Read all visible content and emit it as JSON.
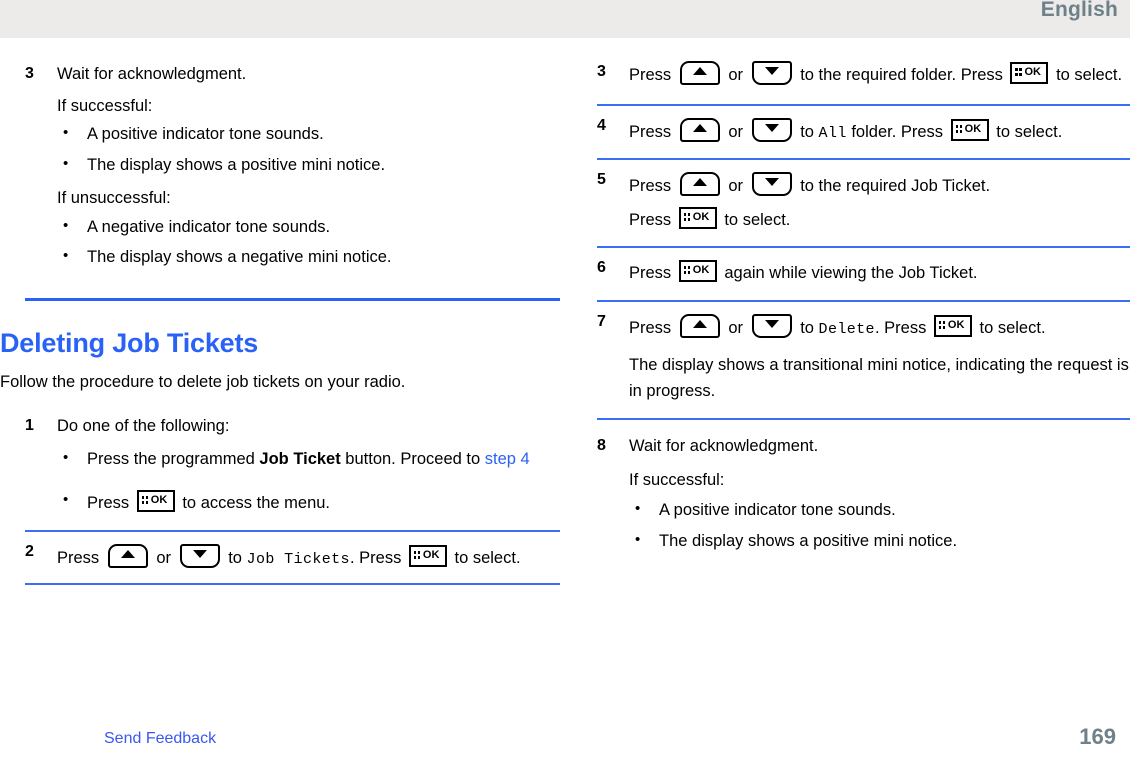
{
  "header": {
    "language": "English"
  },
  "colors": {
    "accent": "#2a62f5",
    "link": "#3a57f0",
    "header_text": "#6e8189",
    "header_band": "#ecebe9"
  },
  "icons": {
    "ok_label": "OK",
    "ok_name": "ok-menu-key-icon",
    "up_name": "up-arrow-key-icon",
    "down_name": "down-arrow-key-icon"
  },
  "left_column": {
    "step3": {
      "number": "3",
      "lead": "Wait for acknowledgment.",
      "success_label": "If successful:",
      "success_bullets": [
        "A positive indicator tone sounds.",
        "The display shows a positive mini notice."
      ],
      "failure_label": "If unsuccessful:",
      "failure_bullets": [
        "A negative indicator tone sounds.",
        "The display shows a negative mini notice."
      ]
    },
    "section": {
      "title": "Deleting Job Tickets",
      "intro": "Follow the procedure to delete job tickets on your radio."
    },
    "step1": {
      "number": "1",
      "lead": "Do one of the following:",
      "bullet1_pre": "Press the programmed ",
      "bullet1_bold": "Job Ticket",
      "bullet1_post": " button. Proceed to ",
      "bullet1_link": "step 4",
      "bullet2_pre": "Press ",
      "bullet2_post": " to access the menu."
    },
    "step2": {
      "number": "2",
      "t1": "Press ",
      "t2": " or ",
      "t3": " to ",
      "mono": "Job Tickets",
      "t4": ". Press ",
      "t5": " to select."
    }
  },
  "right_column": {
    "step3": {
      "number": "3",
      "t1": "Press ",
      "t2": " or ",
      "t3": " to the required folder. Press ",
      "t4": " to select."
    },
    "step4": {
      "number": "4",
      "t1": "Press ",
      "t2": " or ",
      "t3": " to ",
      "mono": "All",
      "t4": " folder. Press ",
      "t5": " to select."
    },
    "step5": {
      "number": "5",
      "t1": "Press ",
      "t2": " or ",
      "t3": " to the required Job Ticket.",
      "t4": "Press ",
      "t5": " to select."
    },
    "step6": {
      "number": "6",
      "t1": "Press ",
      "t2": " again while viewing the Job Ticket."
    },
    "step7": {
      "number": "7",
      "t1": "Press ",
      "t2": " or ",
      "t3": " to ",
      "mono": "Delete",
      "t4": ". Press ",
      "t5": " to select.",
      "note": "The display shows a transitional mini notice, indicating the request is in progress."
    },
    "step8": {
      "number": "8",
      "lead": "Wait for acknowledgment.",
      "success_label": "If successful:",
      "success_bullets": [
        "A positive indicator tone sounds.",
        "The display shows a positive mini notice."
      ]
    }
  },
  "footer": {
    "feedback": "Send Feedback",
    "page_number": "169"
  }
}
